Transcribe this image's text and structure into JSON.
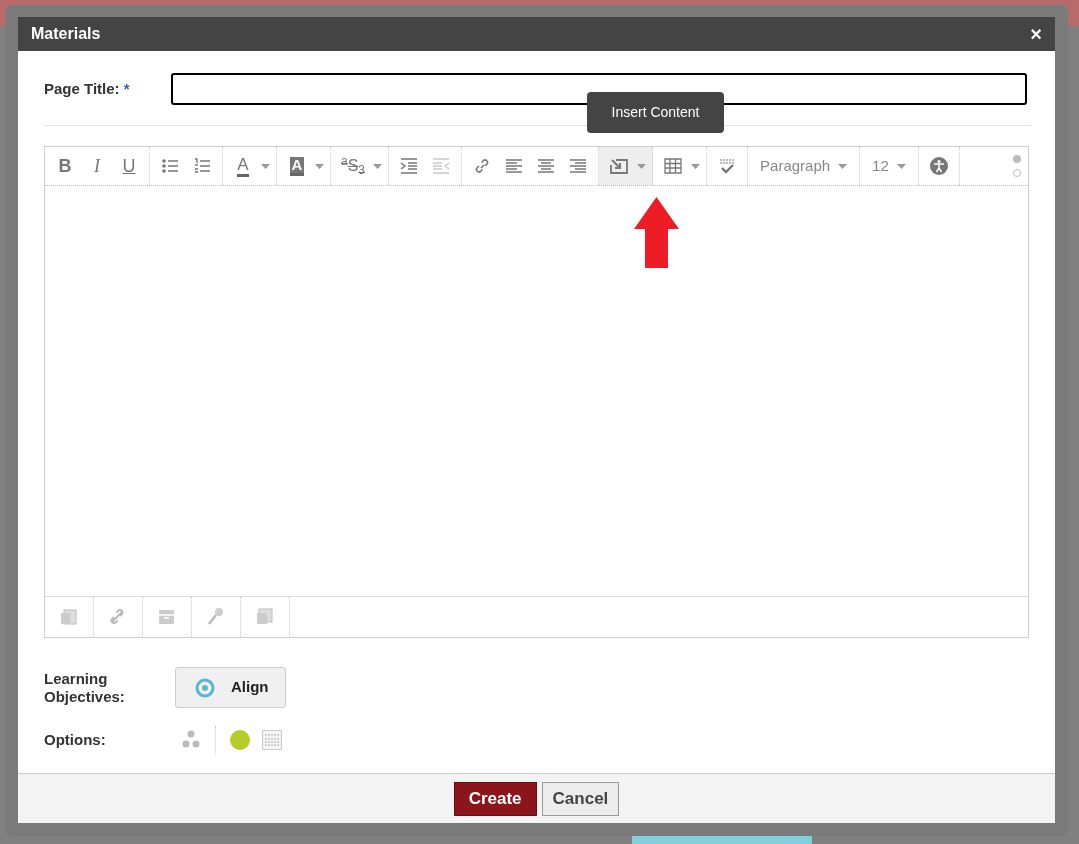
{
  "dialog": {
    "title": "Materials",
    "close": "×"
  },
  "page_title": {
    "label": "Page Title:",
    "required_mark": "*"
  },
  "toolbar": [
    {
      "kind": "buttons",
      "dropdown": false,
      "selected": false,
      "items": [
        {
          "kind": "glyph",
          "label": "B",
          "disabled": false
        },
        {
          "kind": "glyph",
          "label": "I",
          "disabled": false
        },
        {
          "kind": "glyph",
          "label": "U",
          "disabled": false
        }
      ]
    },
    {
      "kind": "buttons",
      "dropdown": false,
      "selected": false,
      "items": [
        {
          "kind": "icon",
          "disabled": false
        },
        {
          "kind": "icon",
          "disabled": false
        }
      ]
    },
    {
      "kind": "buttons",
      "dropdown": true,
      "selected": false,
      "items": [
        {
          "kind": "glyph",
          "label": "A",
          "disabled": false
        }
      ]
    },
    {
      "kind": "buttons",
      "dropdown": true,
      "selected": false,
      "items": [
        {
          "kind": "glyph",
          "label": "A",
          "disabled": false
        }
      ]
    },
    {
      "kind": "buttons",
      "dropdown": true,
      "selected": false,
      "items": [
        {
          "kind": "glyph",
          "label": "$^{a}$S$_{3}$",
          "disabled": false
        }
      ]
    },
    {
      "kind": "buttons",
      "dropdown": false,
      "selected": false,
      "items": [
        {
          "kind": "icon",
          "disabled": false
        },
        {
          "kind": "icon",
          "disabled": true
        }
      ]
    },
    {
      "kind": "buttons",
      "dropdown": false,
      "selected": false,
      "items": [
        {
          "kind": "icon",
          "disabled": false
        },
        {
          "kind": "icon",
          "disabled": false
        },
        {
          "kind": "icon",
          "disabled": false
        },
        {
          "kind": "icon",
          "disabled": false
        }
      ]
    },
    {
      "kind": "buttons",
      "dropdown": true,
      "selected": true,
      "items": [
        {
          "kind": "icon",
          "disabled": false
        }
      ]
    },
    {
      "kind": "buttons",
      "dropdown": true,
      "selected": false,
      "items": [
        {
          "kind": "icon",
          "disabled": false
        }
      ]
    },
    {
      "kind": "buttons",
      "dropdown": false,
      "selected": false,
      "items": [
        {
          "kind": "icon",
          "disabled": false
        }
      ]
    },
    {
      "kind": "select",
      "value": "Paragraph"
    },
    {
      "kind": "select",
      "value": "12"
    },
    {
      "kind": "buttons",
      "dropdown": false,
      "selected": false,
      "items": [
        {
          "kind": "icon",
          "disabled": false
        }
      ]
    }
  ],
  "tooltip": "Insert Content",
  "learning_objectives": {
    "label": "Learning Objectives:",
    "button": "Align"
  },
  "options": {
    "label": "Options:"
  },
  "buttons": [
    {
      "kind": "primary",
      "label": "Create"
    },
    {
      "kind": "secondary",
      "label": "Cancel"
    }
  ]
}
